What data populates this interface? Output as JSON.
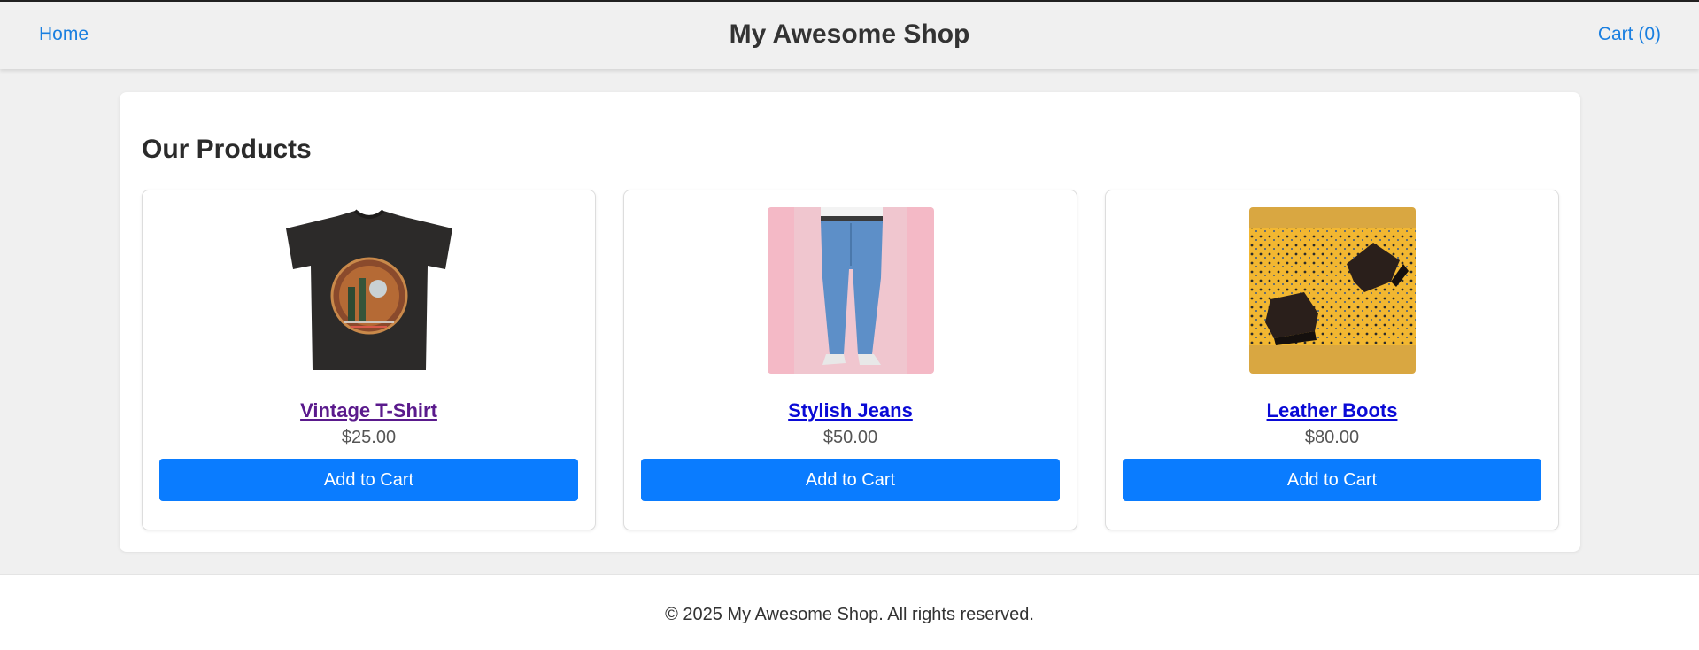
{
  "header": {
    "home_label": "Home",
    "title": "My Awesome Shop",
    "cart_label": "Cart (0)"
  },
  "main": {
    "section_title": "Our Products",
    "products": [
      {
        "name": "Vintage T-Shirt",
        "price": "$25.00",
        "button_label": "Add to Cart",
        "image": "t-shirt-image"
      },
      {
        "name": "Stylish Jeans",
        "price": "$50.00",
        "button_label": "Add to Cart",
        "image": "jeans-image"
      },
      {
        "name": "Leather Boots",
        "price": "$80.00",
        "button_label": "Add to Cart",
        "image": "boots-image"
      }
    ]
  },
  "footer": {
    "copyright": "© 2025 My Awesome Shop. All rights reserved."
  },
  "colors": {
    "link": "#1a7fe0",
    "button": "#0a7cff",
    "visited_link": "#5a1a8c",
    "product_link": "#0a0ad6"
  }
}
